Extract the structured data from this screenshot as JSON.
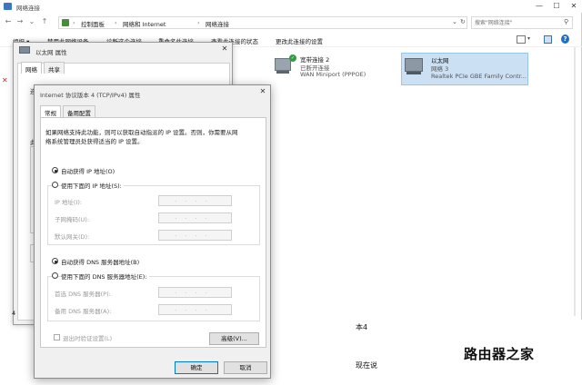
{
  "window": {
    "title": "网络连接",
    "controls": {
      "minimize": "—",
      "maximize": "☐",
      "close": "✕"
    }
  },
  "address_bar": {
    "path": [
      "控制面板",
      "网络和 Internet",
      "网络连接"
    ],
    "separator": "›"
  },
  "search": {
    "placeholder": "搜索\"网络连接\""
  },
  "command_bar": {
    "organize": "组织 ▾",
    "items": [
      "禁用此网络设备",
      "诊断这个连接",
      "重命名此连接",
      "查看此连接的状态",
      "更改此连接的设置"
    ]
  },
  "adapters": [
    {
      "name": "宽带连接 2",
      "status": "已断开连接",
      "device": "WAN Miniport (PPPOE)"
    },
    {
      "name": "以太网",
      "status": "网络 3",
      "device": "Realtek PCIe GBE Family Contr..."
    }
  ],
  "background_page": {
    "line1": "本4",
    "line2": "现在说",
    "watermark": "路由器之家"
  },
  "ethernet_dialog": {
    "title": "以太网 属性",
    "tabs": [
      "网络",
      "共享"
    ],
    "partial_left": [
      "连",
      "此"
    ],
    "bottom_digit": "4"
  },
  "ipv4_dialog": {
    "title": "Internet 协议版本 4 (TCP/IPv4) 属性",
    "close": "✕",
    "tabs": [
      "常规",
      "备用配置"
    ],
    "intro": [
      "如果网络支持此功能，则可以获取自动指派的 IP 设置。否则，你需要从网",
      "络系统管理员处获得适当的 IP 设置。"
    ],
    "auto_ip": {
      "label": "自动获得 IP 地址(O)",
      "selected": true
    },
    "manual_ip": {
      "label": "使用下面的 IP 地址(S):",
      "selected": false
    },
    "ip_fields": [
      {
        "label": "IP 地址(I):",
        "value": "...."
      },
      {
        "label": "子网掩码(U):",
        "value": "...."
      },
      {
        "label": "默认网关(D):",
        "value": "...."
      }
    ],
    "auto_dns": {
      "label": "自动获得 DNS 服务器地址(B)",
      "selected": true
    },
    "manual_dns": {
      "label": "使用下面的 DNS 服务器地址(E):",
      "selected": false
    },
    "dns_fields": [
      {
        "label": "首选 DNS 服务器(P):",
        "value": "...."
      },
      {
        "label": "备用 DNS 服务器(A):",
        "value": "...."
      }
    ],
    "validate": {
      "label": "退出时验证设置(L)",
      "checked": false
    },
    "advanced_button": "高级(V)...",
    "ok_button": "确定",
    "cancel_button": "取消"
  },
  "colors": {
    "selection": "#cce0f3",
    "accent": "#0078d7",
    "dialog_bg": "#f0f0f0"
  }
}
